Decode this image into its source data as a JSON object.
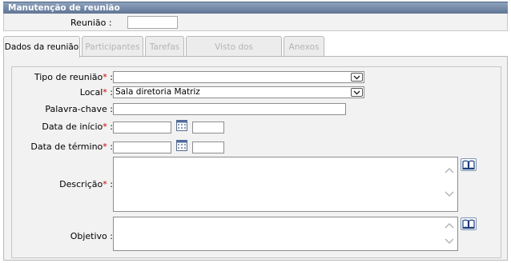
{
  "header": {
    "title": "Manutenção de reunião"
  },
  "top": {
    "reuniao_label": "Reunião :",
    "reuniao_value": ""
  },
  "tabs": [
    {
      "label": "Dados da reunião",
      "active": true
    },
    {
      "label": "Participantes",
      "active": false
    },
    {
      "label": "Tarefas",
      "active": false
    },
    {
      "label": "Visto dos participantes",
      "active": false
    },
    {
      "label": "Anexos",
      "active": false
    }
  ],
  "form": {
    "tipo": {
      "label": "Tipo de reunião",
      "value": ""
    },
    "local": {
      "label": "Local",
      "value": "Sala diretoria Matriz"
    },
    "palavra": {
      "label": "Palavra-chave :",
      "value": ""
    },
    "inicio": {
      "label": "Data de início",
      "date": "",
      "time": ""
    },
    "termino": {
      "label": "Data de término",
      "date": "",
      "time": ""
    },
    "descricao": {
      "label": "Descrição",
      "value": ""
    },
    "objetivo": {
      "label": "Objetivo :",
      "value": ""
    },
    "required_mark": "*",
    "colon": ":"
  },
  "colors": {
    "header": "#6a7f9c",
    "required": "#d00000"
  }
}
